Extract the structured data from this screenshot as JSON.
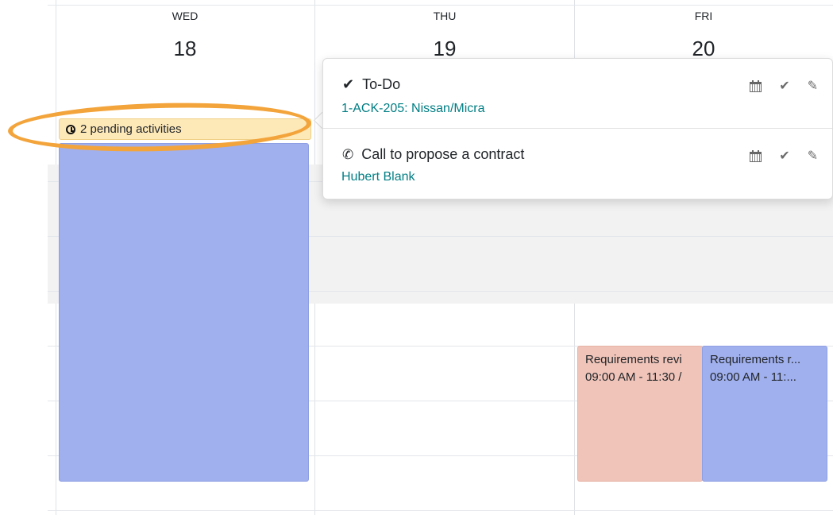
{
  "days": [
    {
      "name": "WED",
      "number": "18"
    },
    {
      "name": "THU",
      "number": "19"
    },
    {
      "name": "FRI",
      "number": "20"
    }
  ],
  "pending": {
    "label": "2 pending activities",
    "icon": "clock-icon"
  },
  "popover": {
    "activities": [
      {
        "title": "To-Do",
        "icon": "check-icon",
        "link": "1-ACK-205: Nissan/Micra"
      },
      {
        "title": "Call to propose a contract",
        "icon": "phone-icon",
        "link": "Hubert Blank"
      }
    ],
    "action_icons": [
      "calendar-icon",
      "check-icon",
      "pencil-icon"
    ]
  },
  "events": [
    {
      "title": "Requirements revi",
      "time": "09:00 AM - 11:30 /",
      "color": "#f0c4b9"
    },
    {
      "title": "Requirements r...",
      "time": "09:00 AM - 11:...",
      "color": "#a0b0ee"
    }
  ],
  "colors": {
    "accent_link": "#017e84",
    "highlight_ring": "#f3a43b",
    "pending_bg": "#fde8b8"
  }
}
